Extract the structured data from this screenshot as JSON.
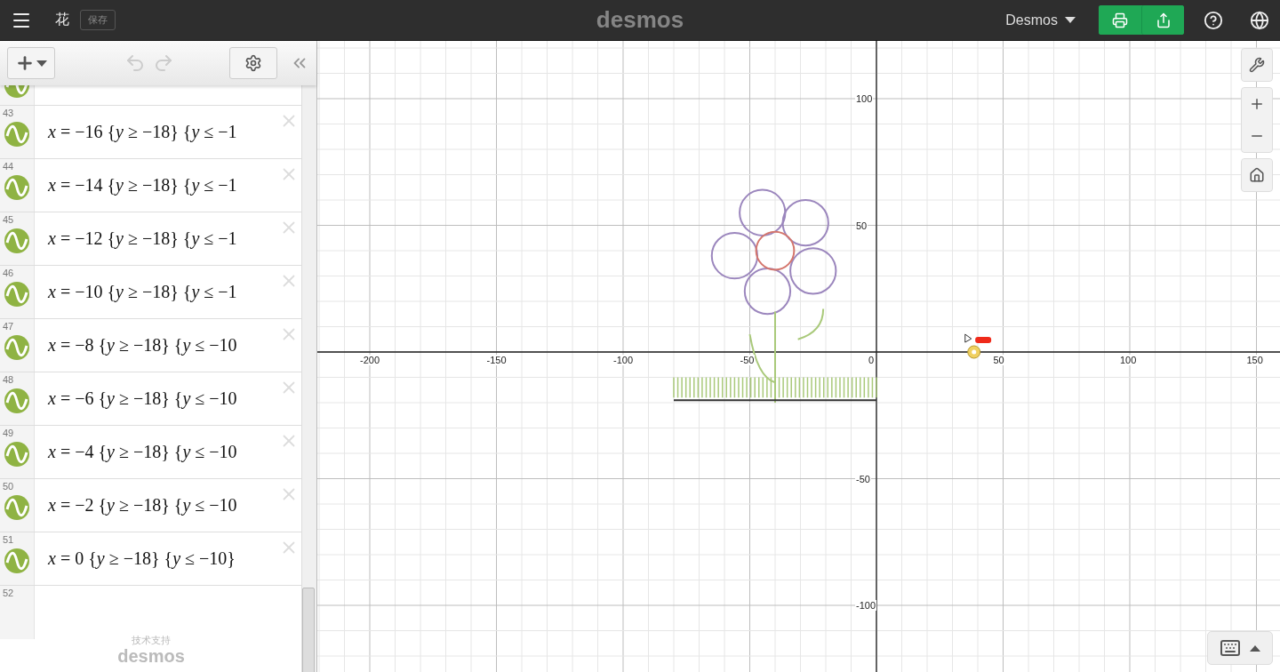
{
  "header": {
    "title": "花",
    "save_button": "保存",
    "logo": "desmos",
    "account": "Desmos"
  },
  "expressions": [
    {
      "number": "43",
      "latex": "*x* = −16 {*y* ≥ −18} {*y* ≤ −1"
    },
    {
      "number": "44",
      "latex": "*x* = −14 {*y* ≥ −18} {*y* ≤ −1"
    },
    {
      "number": "45",
      "latex": "*x* = −12 {*y* ≥ −18} {*y* ≤ −1"
    },
    {
      "number": "46",
      "latex": "*x* = −10 {*y* ≥ −18} {*y* ≤ −1"
    },
    {
      "number": "47",
      "latex": "*x* = −8 {*y* ≥ −18} {*y* ≤ −10"
    },
    {
      "number": "48",
      "latex": "*x* = −6 {*y* ≥ −18} {*y* ≤ −10"
    },
    {
      "number": "49",
      "latex": "*x* = −4 {*y* ≥ −18} {*y* ≤ −10"
    },
    {
      "number": "50",
      "latex": "*x* = −2 {*y* ≥ −18} {*y* ≤ −10"
    },
    {
      "number": "51",
      "latex": "*x* = 0 {*y* ≥ −18} {*y* ≤ −10}"
    }
  ],
  "new_expression_number": "52",
  "footer": {
    "credit": "技术支持",
    "brand": "desmos"
  },
  "graph": {
    "x_ticks": [
      "-200",
      "-150",
      "-100",
      "-50",
      "0",
      "50",
      "100",
      "150"
    ],
    "y_ticks": [
      "100",
      "50",
      "-50",
      "-100"
    ]
  }
}
